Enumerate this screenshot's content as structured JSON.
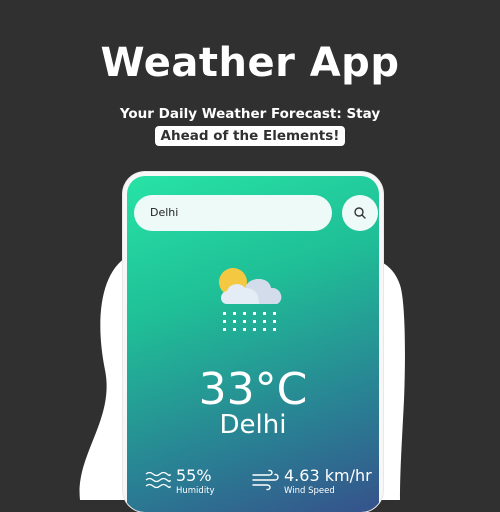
{
  "header": {
    "title": "Weather App",
    "subtitle_line1": "Your Daily Weather Forecast: Stay",
    "subtitle_line2": "Ahead of the Elements!"
  },
  "app": {
    "search": {
      "value": "Delhi",
      "button_icon": "search-icon"
    },
    "weather": {
      "icon": "partly-cloudy-snow-icon",
      "temperature": "33°C",
      "city": "Delhi"
    },
    "stats": {
      "humidity": {
        "value": "55%",
        "label": "Humidity",
        "icon": "humidity-icon"
      },
      "wind": {
        "value": "4.63 km/hr",
        "label": "Wind Speed",
        "icon": "wind-icon"
      }
    }
  },
  "colors": {
    "background": "#303030",
    "gradient_top": "#27e3a5",
    "gradient_bottom": "#36528b",
    "sun": "#f5c842",
    "cloud": "#e4ecf5"
  }
}
